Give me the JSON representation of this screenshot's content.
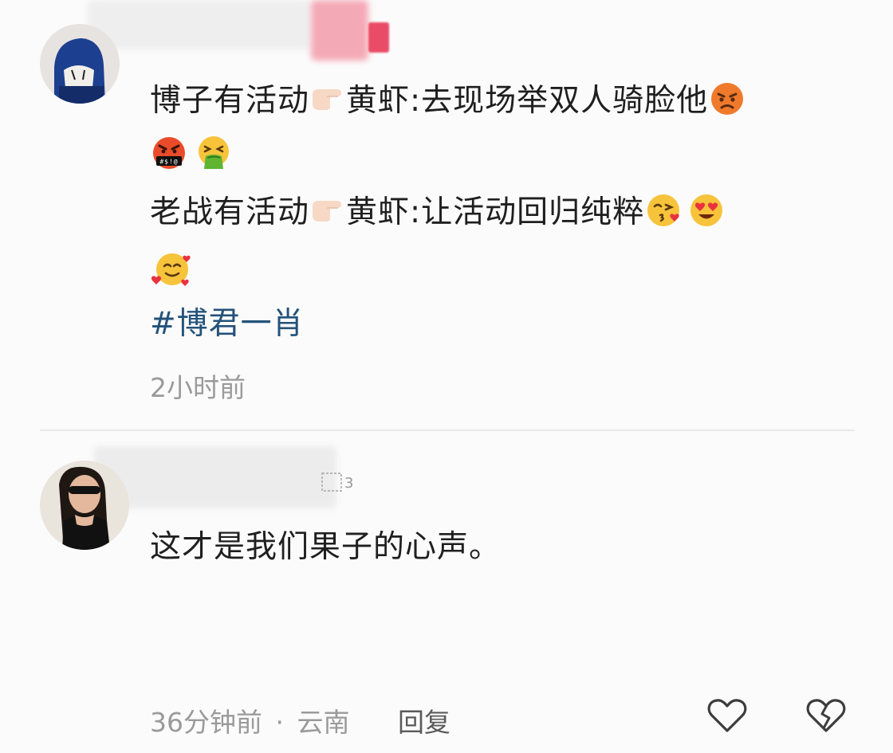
{
  "comments": [
    {
      "lines": [
        "博子有活动",
        "黄虾:去现场举双人骑脸他",
        "老战有活动",
        "黄虾:让活动回归纯粹"
      ],
      "emoji": [
        "backhand-index-pointing-right",
        "pouting-face",
        "face-with-symbols-on-mouth",
        "face-vomiting",
        "face-blowing-a-kiss",
        "smiling-face-with-heart-eyes",
        "smiling-face-with-hearts"
      ],
      "hashtag": "#博君一肖",
      "time": "2小时前"
    },
    {
      "text": "这才是我们果子的心声。",
      "time": "36分钟前",
      "dot": "·",
      "location": "云南",
      "reply_label": "回复"
    }
  ],
  "colors": {
    "hashtag": "#24527a",
    "meta": "#9a9a9a",
    "divider": "#e9e9e9"
  },
  "icons": [
    "heart-icon",
    "broken-heart-icon"
  ]
}
